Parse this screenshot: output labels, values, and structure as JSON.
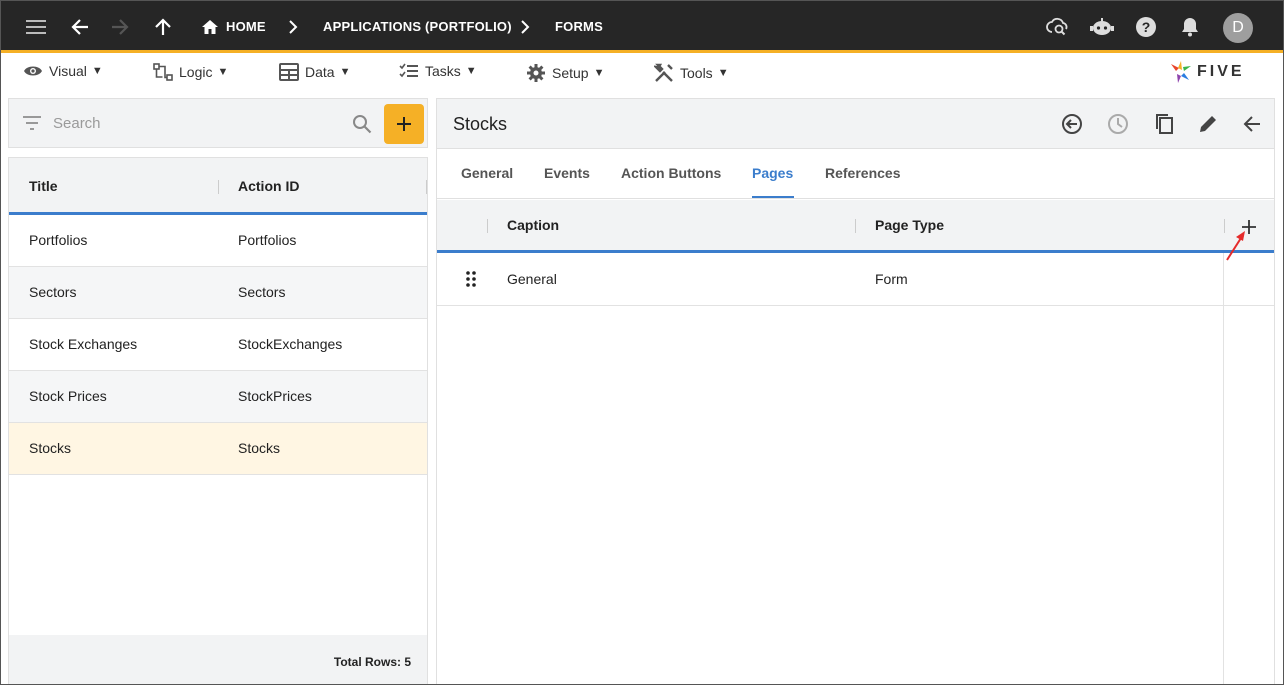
{
  "appbar": {
    "breadcrumbs": [
      "HOME",
      "APPLICATIONS (PORTFOLIO)",
      "FORMS"
    ],
    "avatar_letter": "D",
    "icons": [
      "menu-icon",
      "back-icon",
      "forward-icon",
      "up-icon",
      "home-icon",
      "chevron-right-icon",
      "cloud-search-icon",
      "chatbot-icon",
      "help-icon",
      "bell-icon"
    ]
  },
  "menubar": {
    "items": [
      {
        "label": "Visual",
        "icon": "eye-icon"
      },
      {
        "label": "Logic",
        "icon": "logic-icon"
      },
      {
        "label": "Data",
        "icon": "table-icon"
      },
      {
        "label": "Tasks",
        "icon": "checklist-icon"
      },
      {
        "label": "Setup",
        "icon": "gear-icon"
      },
      {
        "label": "Tools",
        "icon": "tools-icon"
      }
    ],
    "caret": "▼",
    "logo_text": "FIVE"
  },
  "left": {
    "search_placeholder": "Search",
    "columns": [
      "Title",
      "Action ID"
    ],
    "rows": [
      {
        "title": "Portfolios",
        "action_id": "Portfolios"
      },
      {
        "title": "Sectors",
        "action_id": "Sectors"
      },
      {
        "title": "Stock Exchanges",
        "action_id": "StockExchanges"
      },
      {
        "title": "Stock Prices",
        "action_id": "StockPrices"
      },
      {
        "title": "Stocks",
        "action_id": "Stocks"
      }
    ],
    "selected_index": 4,
    "footer": "Total Rows: 5"
  },
  "right": {
    "title": "Stocks",
    "tabs": [
      "General",
      "Events",
      "Action Buttons",
      "Pages",
      "References"
    ],
    "active_tab": "Pages",
    "columns": [
      "Caption",
      "Page Type"
    ],
    "rows": [
      {
        "caption": "General",
        "page_type": "Form"
      }
    ]
  },
  "colors": {
    "appbar_bg": "#262626",
    "accent": "#f5b026",
    "link_blue": "#3b7dcc",
    "selected_row": "#fff6e3",
    "annotation_arrow": "#e52b2b"
  }
}
